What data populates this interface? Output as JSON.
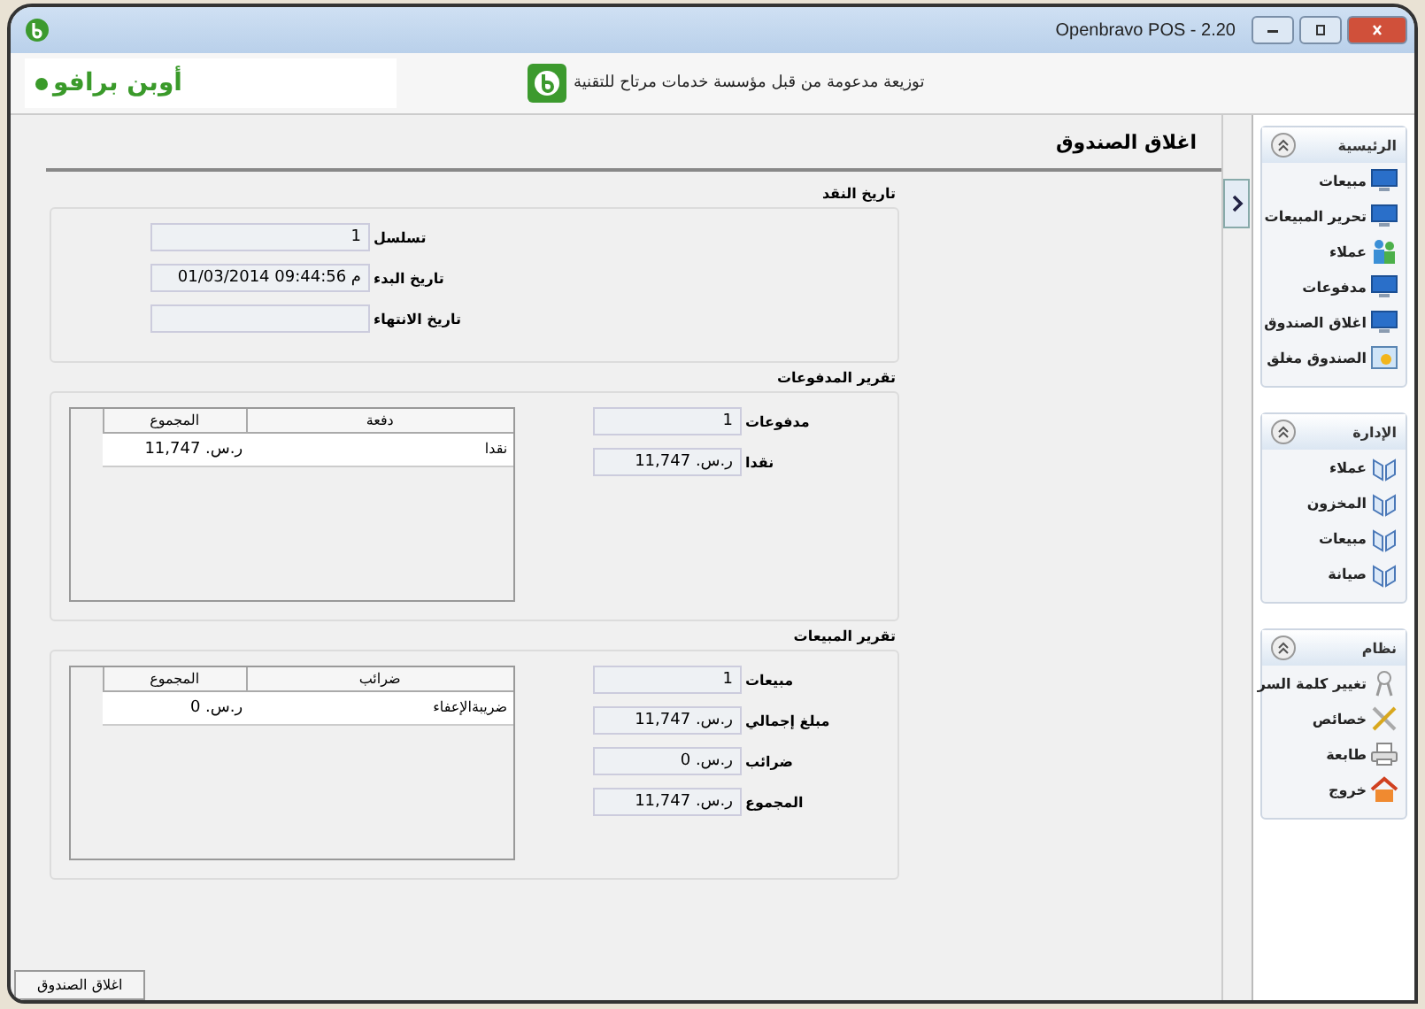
{
  "window": {
    "title": "Openbravo POS - 2.20"
  },
  "header": {
    "logo_text": "أوبن برافو",
    "tagline": "توزيعة مدعومة من قبل مؤسسة خدمات مرتاح للتقنية"
  },
  "page_title": "اغلاق الصندوق",
  "sections": [
    {
      "title": "تاريخ النقد",
      "fields": [
        {
          "label": "تسلسل",
          "value": "1"
        },
        {
          "label": "تاريخ البدء",
          "value": "01/03/2014 09:44:56 م"
        },
        {
          "label": "تاريخ الانتهاء"
        }
      ]
    },
    {
      "title": "تقرير المدفوعات",
      "table": {
        "columns": [
          "دفعة",
          "المجموع"
        ],
        "rows": [
          [
            "نقدا",
            "ر.س. 11,747"
          ]
        ]
      },
      "fields": [
        {
          "label": "مدفوعات",
          "value": "1"
        },
        {
          "label": "نقدا",
          "value": "ر.س. 11,747"
        }
      ]
    },
    {
      "title": "تقرير المبيعات",
      "table": {
        "columns": [
          "ضرائب",
          "المجموع"
        ],
        "rows": [
          [
            "ضريبةالإعفاء",
            "ر.س. 0"
          ]
        ]
      },
      "fields": [
        {
          "label": "مبيعات",
          "value": "1"
        },
        {
          "label": "مبلغ إجمالي",
          "value": "ر.س. 11,747"
        },
        {
          "label": "ضرائب",
          "value": "ر.س. 0"
        },
        {
          "label": "المجموع",
          "value": "ر.س. 11,747"
        }
      ]
    }
  ],
  "close_button": "اغلاق الصندوق",
  "sidebar": [
    {
      "title": "الرئيسية",
      "items": [
        {
          "label": "مبيعات"
        },
        {
          "label": "تحرير المبيعات"
        },
        {
          "label": "عملاء"
        },
        {
          "label": "مدفوعات"
        },
        {
          "label": "اغلاق الصندوق"
        },
        {
          "label": "الصندوق مغلق"
        }
      ]
    },
    {
      "title": "الإدارة",
      "items": [
        {
          "label": "عملاء"
        },
        {
          "label": "المخزون"
        },
        {
          "label": "مبيعات"
        },
        {
          "label": "صيانة"
        }
      ]
    },
    {
      "title": "نظام",
      "items": [
        {
          "label": "تغيير كلمة السر"
        },
        {
          "label": "خصائص"
        },
        {
          "label": "طابعة"
        },
        {
          "label": "خروج"
        }
      ]
    }
  ]
}
